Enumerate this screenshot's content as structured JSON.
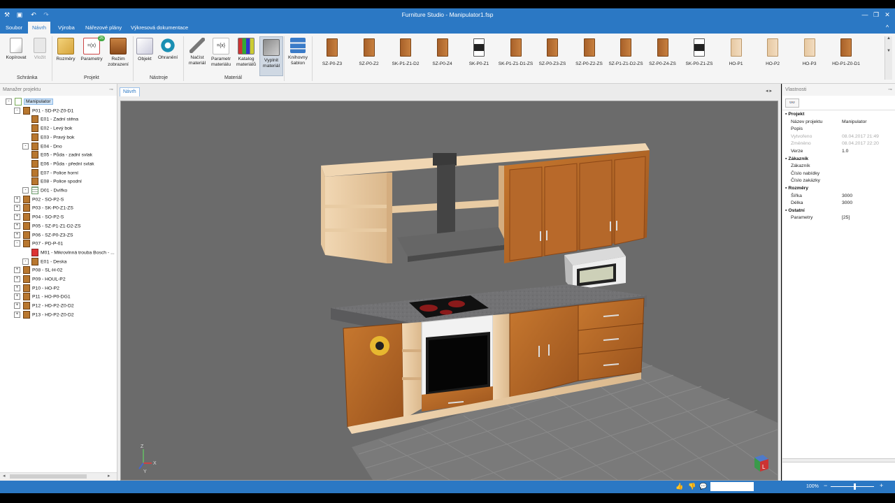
{
  "app": {
    "title": "Furniture Studio - Manipulator1.fsp"
  },
  "menu": {
    "items": [
      "Soubor",
      "Návrh",
      "Výroba",
      "Nářezové plány",
      "Výkresová dokumentace"
    ],
    "active": "Návrh"
  },
  "ribbon": {
    "clipboard": {
      "copy": "Kopírovat",
      "paste": "Vložit",
      "group": "Schránka"
    },
    "project": {
      "dimensions": "Rozměry",
      "parameters": "Parametry",
      "parameters_badge": "25",
      "mode_line1": "Režim",
      "mode_line2": "zobrazení",
      "group": "Projekt"
    },
    "tools": {
      "object": "Objekt",
      "edging": "Ohranění",
      "group": "Nástroje"
    },
    "material": {
      "load_line1": "Načíst",
      "load_line2": "materiál",
      "params_line1": "Parametr",
      "params_line2": "materiálu",
      "catalog_line1": "Katalog",
      "catalog_line2": "materiálů",
      "fill_line1": "Vyplnit",
      "fill_line2": "materiál",
      "group": "Materiál"
    },
    "library": {
      "line1": "Knihovny",
      "line2": "šablon"
    },
    "gallery": [
      "SZ-P0-Z3",
      "SZ-P0-Z2",
      "SK-P1-Z1-D2",
      "SZ-P0-Z4",
      "SK-P0-Z1",
      "SK-P1-Z1-D1-ZS",
      "SZ-P0-Z3-ZS",
      "SZ-P0-Z2-ZS",
      "SZ-P1-Z1-D2-ZS",
      "SZ-P0-Z4-ZS",
      "SK-P0-Z1-ZS",
      "HO-P1",
      "HO-P2",
      "HO-P3",
      "HD-P1-Z0-D1"
    ]
  },
  "project_manager": {
    "header": "Manažer projektu",
    "rows": [
      {
        "label": "Manipulator",
        "indent": 0,
        "exp": "-",
        "icon": "doc",
        "selected": true
      },
      {
        "label": "P01 - SD-P2-Z0-D1",
        "indent": 1,
        "exp": "-",
        "icon": "cab"
      },
      {
        "label": "E01 - Zadní stěna",
        "indent": 2,
        "exp": "",
        "icon": "cab"
      },
      {
        "label": "E02 - Levý bok",
        "indent": 2,
        "exp": "",
        "icon": "cab"
      },
      {
        "label": "E03 - Pravý bok",
        "indent": 2,
        "exp": "",
        "icon": "cab"
      },
      {
        "label": "E04 - Dno",
        "indent": 2,
        "exp": "-",
        "icon": "cab"
      },
      {
        "label": "E05 - Půda - zadní svlak",
        "indent": 2,
        "exp": "",
        "icon": "cab"
      },
      {
        "label": "E06 - Půda - přední svlak",
        "indent": 2,
        "exp": "",
        "icon": "cab"
      },
      {
        "label": "E07 - Police horní",
        "indent": 2,
        "exp": "",
        "icon": "cab"
      },
      {
        "label": "E08 - Police spodní",
        "indent": 2,
        "exp": "",
        "icon": "cab"
      },
      {
        "label": "D01 - Dvířko",
        "indent": 2,
        "exp": "-",
        "icon": "grid"
      },
      {
        "label": "P02 - SO-P2-S",
        "indent": 1,
        "exp": "+",
        "icon": "cab"
      },
      {
        "label": "P03 - SK-P0-Z1-ZS",
        "indent": 1,
        "exp": "+",
        "icon": "cab"
      },
      {
        "label": "P04 - SO-P2-S",
        "indent": 1,
        "exp": "+",
        "icon": "cab"
      },
      {
        "label": "P05 - SZ-P1-Z1-D2-ZS",
        "indent": 1,
        "exp": "+",
        "icon": "cab"
      },
      {
        "label": "P06 - SZ-P0-Z3-ZS",
        "indent": 1,
        "exp": "+",
        "icon": "cab"
      },
      {
        "label": "P07 - PD-P-01",
        "indent": 1,
        "exp": "-",
        "icon": "cab"
      },
      {
        "label": "M01 - Mikrovlnná trouba Bosch - ...",
        "indent": 2,
        "exp": "",
        "icon": "mw"
      },
      {
        "label": "E01 - Deska",
        "indent": 2,
        "exp": "-",
        "icon": "cab"
      },
      {
        "label": "P08 - SL-H-02",
        "indent": 1,
        "exp": "+",
        "icon": "cab"
      },
      {
        "label": "P09 - HOUL-P2",
        "indent": 1,
        "exp": "+",
        "icon": "cab"
      },
      {
        "label": "P10 - HO-P2",
        "indent": 1,
        "exp": "+",
        "icon": "cab"
      },
      {
        "label": "P11 - HO-P0-DG1",
        "indent": 1,
        "exp": "+",
        "icon": "cab"
      },
      {
        "label": "P12 - HD-P2-Z0-D2",
        "indent": 1,
        "exp": "+",
        "icon": "cab"
      },
      {
        "label": "P13 - HD-P2-Z0-D2",
        "indent": 1,
        "exp": "+",
        "icon": "cab"
      }
    ]
  },
  "viewport": {
    "tab": "Návrh",
    "axis": {
      "z": "Z",
      "x": "X",
      "y": "Y"
    },
    "cube_label": "L"
  },
  "properties": {
    "header": "Vlastnosti",
    "rows": [
      {
        "type": "cat",
        "label": "Projekt"
      },
      {
        "type": "kv",
        "label": "Název projektu",
        "value": "Manipulator"
      },
      {
        "type": "kv",
        "label": "Popis",
        "value": ""
      },
      {
        "type": "dim",
        "label": "Vytvořeno",
        "value": "08.04.2017 21:49"
      },
      {
        "type": "dim",
        "label": "Změněno",
        "value": "08.04.2017 22:20"
      },
      {
        "type": "kv",
        "label": "Verze",
        "value": "1.0"
      },
      {
        "type": "cat",
        "label": "Zákazník"
      },
      {
        "type": "kv",
        "label": "Zákazník",
        "value": ""
      },
      {
        "type": "kv",
        "label": "Číslo nabídky",
        "value": ""
      },
      {
        "type": "kv",
        "label": "Číslo zakázky",
        "value": ""
      },
      {
        "type": "cat",
        "label": "Rozměry"
      },
      {
        "type": "kv",
        "label": "Šířka",
        "value": "3000"
      },
      {
        "type": "kv",
        "label": "Délka",
        "value": "3000"
      },
      {
        "type": "cat",
        "label": "Ostatní"
      },
      {
        "type": "kv",
        "label": "Parametry",
        "value": "[25]"
      }
    ]
  },
  "status": {
    "zoom": "100%",
    "zoom_level": 0.55
  },
  "colors": {
    "accent": "#2b78c4",
    "wood": "#b8692a",
    "countertop": "#6e6e70"
  }
}
